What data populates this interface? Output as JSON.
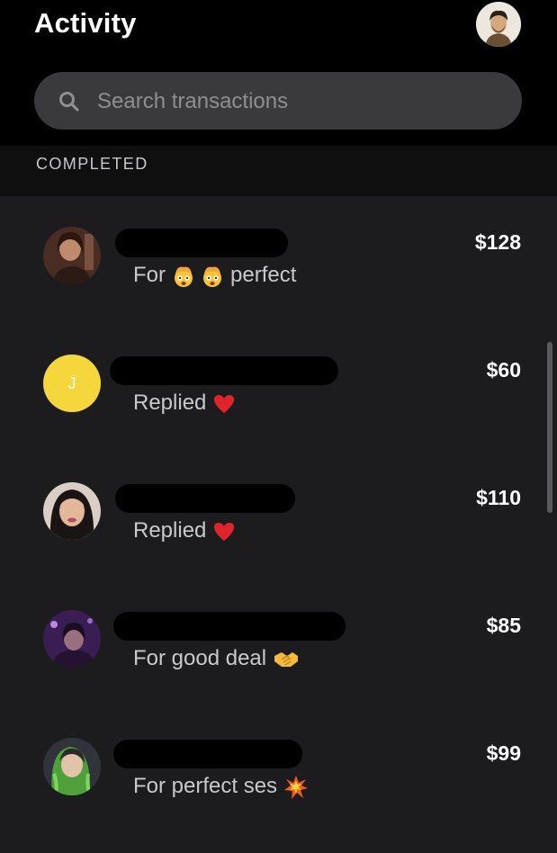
{
  "header": {
    "title": "Activity",
    "profile_icon": "user-avatar"
  },
  "search": {
    "placeholder": "Search transactions",
    "value": ""
  },
  "section": {
    "label": "COMPLETED"
  },
  "transactions": [
    {
      "amount": "$128",
      "note_prefix": "For",
      "note_suffix": "perfect",
      "emojis": [
        "exploding-head",
        "exploding-head"
      ]
    },
    {
      "amount": "$60",
      "initial": "J",
      "note_prefix": "Replied",
      "emojis": [
        "red-heart"
      ]
    },
    {
      "amount": "$110",
      "note_prefix": "Replied",
      "emojis": [
        "red-heart"
      ]
    },
    {
      "amount": "$85",
      "note_prefix": "For good deal",
      "emojis": [
        "handshake"
      ]
    },
    {
      "amount": "$99",
      "note_prefix": "For perfect ses",
      "emojis": [
        "collision"
      ]
    }
  ],
  "colors": {
    "background": "#1c1c1e",
    "header": "#000000",
    "search_field": "#3a3a3c",
    "initial_avatar": "#f5d63d",
    "heart": "#e0242c"
  }
}
